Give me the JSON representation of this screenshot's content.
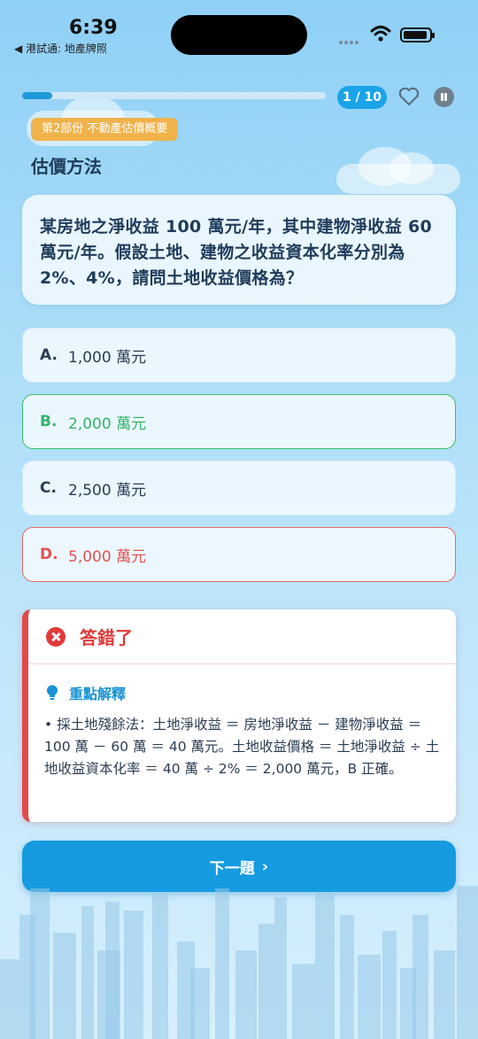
{
  "status_bar": {
    "time": "6:39",
    "back_app": "◀ 港試通: 地產牌照"
  },
  "header": {
    "progress_fraction": 0.1,
    "counter": "1 / 10"
  },
  "section": {
    "badge": "第2部份 不動產估價概要",
    "topic": "估價方法"
  },
  "question": {
    "text": "某房地之淨收益 100 萬元/年，其中建物淨收益 60 萬元/年。假設土地、建物之收益資本化率分別為 2%、4%，請問土地收益價格為？"
  },
  "options": [
    {
      "letter": "A.",
      "text": "1,000 萬元",
      "state": "neutral"
    },
    {
      "letter": "B.",
      "text": "2,000 萬元",
      "state": "correct"
    },
    {
      "letter": "C.",
      "text": "2,500 萬元",
      "state": "neutral"
    },
    {
      "letter": "D.",
      "text": "5,000 萬元",
      "state": "wrong-selected"
    }
  ],
  "feedback": {
    "title": "答錯了",
    "explain_title": "重點解釋",
    "explain_text": "• 採土地殘餘法：土地淨收益 ＝ 房地淨收益 － 建物淨收益 ＝ 100 萬 － 60 萬 ＝ 40 萬元。土地收益價格 ＝ 土地淨收益 ÷ 土地收益資本化率 ＝ 40 萬 ÷ 2% ＝ 2,000 萬元，B 正確。"
  },
  "next_button": {
    "label": "下一題"
  },
  "colors": {
    "accent": "#169be0",
    "correct": "#34b468",
    "wrong": "#e03a3a",
    "badge": "#f0b24b"
  }
}
